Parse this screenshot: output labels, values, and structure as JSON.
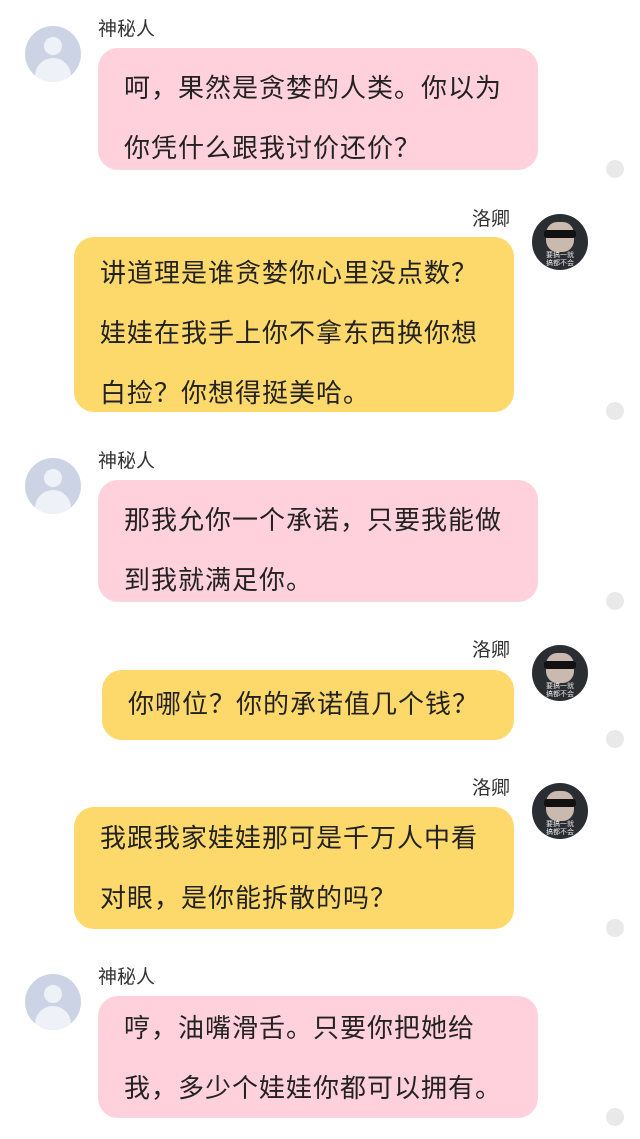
{
  "messages": [
    {
      "sender": "神秘人",
      "side": "left",
      "lines": [
        "呵，果然是贪婪的人类。你以为",
        "你凭什么跟我讨价还价？"
      ]
    },
    {
      "sender": "洛卿",
      "side": "right",
      "lines": [
        "讲道理是谁贪婪你心里没点数？",
        "娃娃在我手上你不拿东西换你想",
        "白捡？你想得挺美哈。"
      ]
    },
    {
      "sender": "神秘人",
      "side": "left",
      "lines": [
        "那我允你一个承诺，只要我能做",
        "到我就满足你。"
      ]
    },
    {
      "sender": "洛卿",
      "side": "right",
      "lines": [
        "你哪位？你的承诺值几个钱？"
      ]
    },
    {
      "sender": "洛卿",
      "side": "right",
      "lines": [
        "我跟我家娃娃那可是千万人中看",
        "对眼，是你能拆散的吗？"
      ]
    },
    {
      "sender": "神秘人",
      "side": "left",
      "lines": [
        "哼，油嘴滑舌。只要你把她给",
        "我，多少个娃娃你都可以拥有。"
      ]
    }
  ],
  "avatar_caption": [
    "要搞一就",
    "搞都不会"
  ],
  "colors": {
    "left_bubble": "#ffd1dd",
    "right_bubble": "#fdd96b",
    "default_avatar": "#ccd3e4",
    "status_dot": "#e9e9e9"
  }
}
